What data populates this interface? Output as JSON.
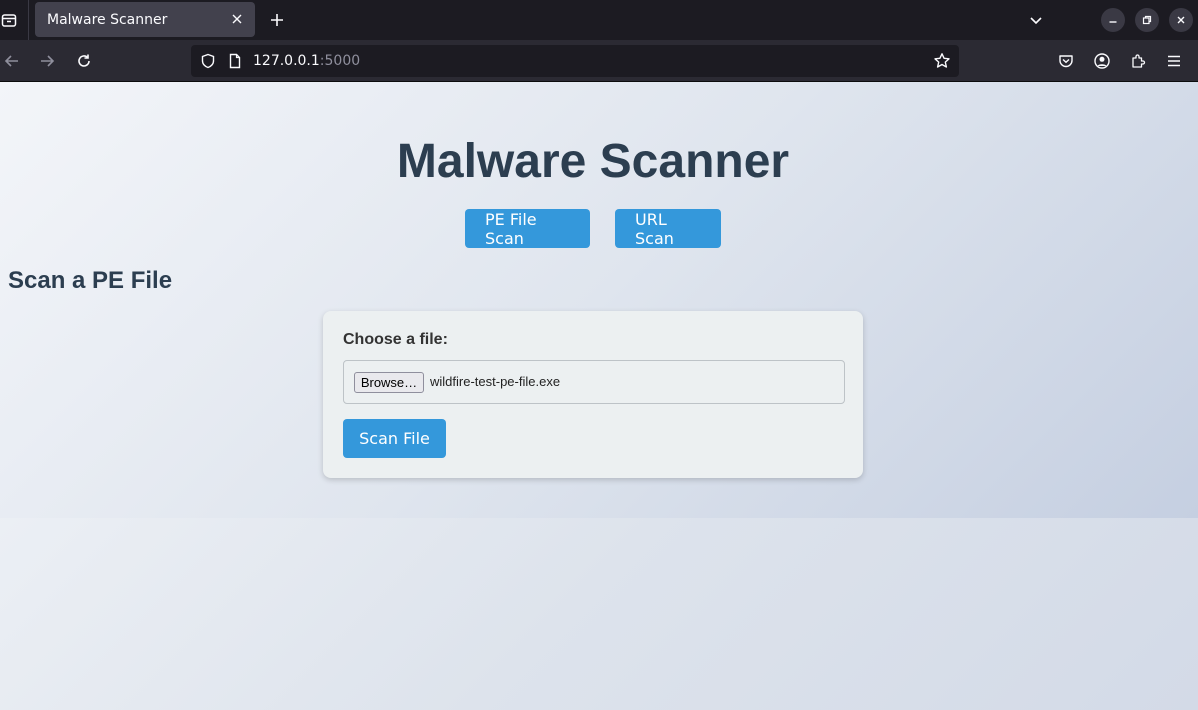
{
  "browser": {
    "tab_title": "Malware Scanner",
    "url_host": "127.0.0.1",
    "url_port": ":5000"
  },
  "page": {
    "title": "Malware Scanner",
    "nav": {
      "pe_scan_label": "PE File Scan",
      "url_scan_label": "URL Scan"
    },
    "section_title": "Scan a PE File",
    "form": {
      "file_label": "Choose a file:",
      "browse_label": "Browse…",
      "selected_file": "wildfire-test-pe-file.exe",
      "submit_label": "Scan File"
    }
  },
  "colors": {
    "accent": "#3498db",
    "heading": "#2c3e50",
    "card_bg": "#ecf0f1"
  },
  "icons": [
    "tab-list-icon",
    "close-icon",
    "plus-icon",
    "chevron-down-icon",
    "minimize-icon",
    "restore-icon",
    "window-close-icon",
    "back-icon",
    "forward-icon",
    "reload-icon",
    "shield-icon",
    "page-icon",
    "star-icon",
    "pocket-icon",
    "account-icon",
    "extensions-icon",
    "menu-icon"
  ]
}
